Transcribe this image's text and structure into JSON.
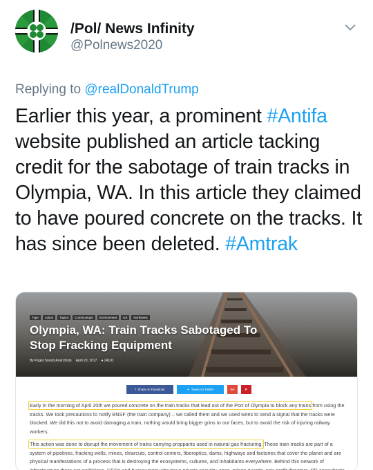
{
  "account": {
    "display_name": "/Pol/ News Infinity",
    "handle": "@Polnews2020",
    "avatar_icon": "clover-flag-avatar-icon"
  },
  "reply": {
    "prefix": "Replying to",
    "mention": "@realDonaldTrump"
  },
  "tweet_text": {
    "l1_a": "Earlier this year, a prominent ",
    "l1_tag": "#Antifa",
    "l2": "website published an article tacking",
    "l3": "credit for the sabotage of train tracks in",
    "l4": "Olympia, WA. In this article they claimed",
    "l5": "to have poured concrete on the tracks. It",
    "l6_a": "has since been deleted. ",
    "l6_tag": "#Amtrak"
  },
  "embed": {
    "crumbs": [
      "Type",
      "Action",
      "Topics",
      "Communique",
      "Environment",
      "US",
      "Northwest"
    ],
    "title_line1": "Olympia, WA: Train Tracks Sabotaged To",
    "title_line2": "Stop Fracking Equipment",
    "meta_author": "By Puget Sound Anarchists",
    "meta_date": "April 20, 2017",
    "meta_views": "24101",
    "share": {
      "facebook": "Share on Facebook",
      "twitter": "Tweet on Twitter",
      "gplus": "G+",
      "pinterest": "P"
    },
    "para1_highlight": "Early in the morning of April 20th we poured concrete on the train tracks that lead out of the Port of Olympia to block any trains",
    "para1_rest": " from using the tracks. We took precautions to notify BNSF (the train company) – we called them and we used wires to send a signal that the tracks were blocked. We did this not to avoid damaging a train, nothing would bring bigger grins to our faces, but to avoid the risk of injuring railway workers.",
    "para2_highlight": "This action was done to disrupt the movement of trains carrying proppants used in natural gas fracturing.",
    "para2_rest": " These train tracks are part of a system of pipelines, fracking wells, mines, clearcuts, control centers, fiberoptics, dams, highways and factories that cover the planet and are physical manifestations of a process that is destroying the ecosystems, cultures, and inhabitants everywhere. Behind this network of infrastructure there are politicians, CEOs and bureaucrats who have private security, cops, prison guards, non-profit directors, PR consultants"
  },
  "colors": {
    "link_blue": "#1da1f2",
    "secondary_gray": "#657786",
    "highlight_yellow": "#f2d13a"
  }
}
